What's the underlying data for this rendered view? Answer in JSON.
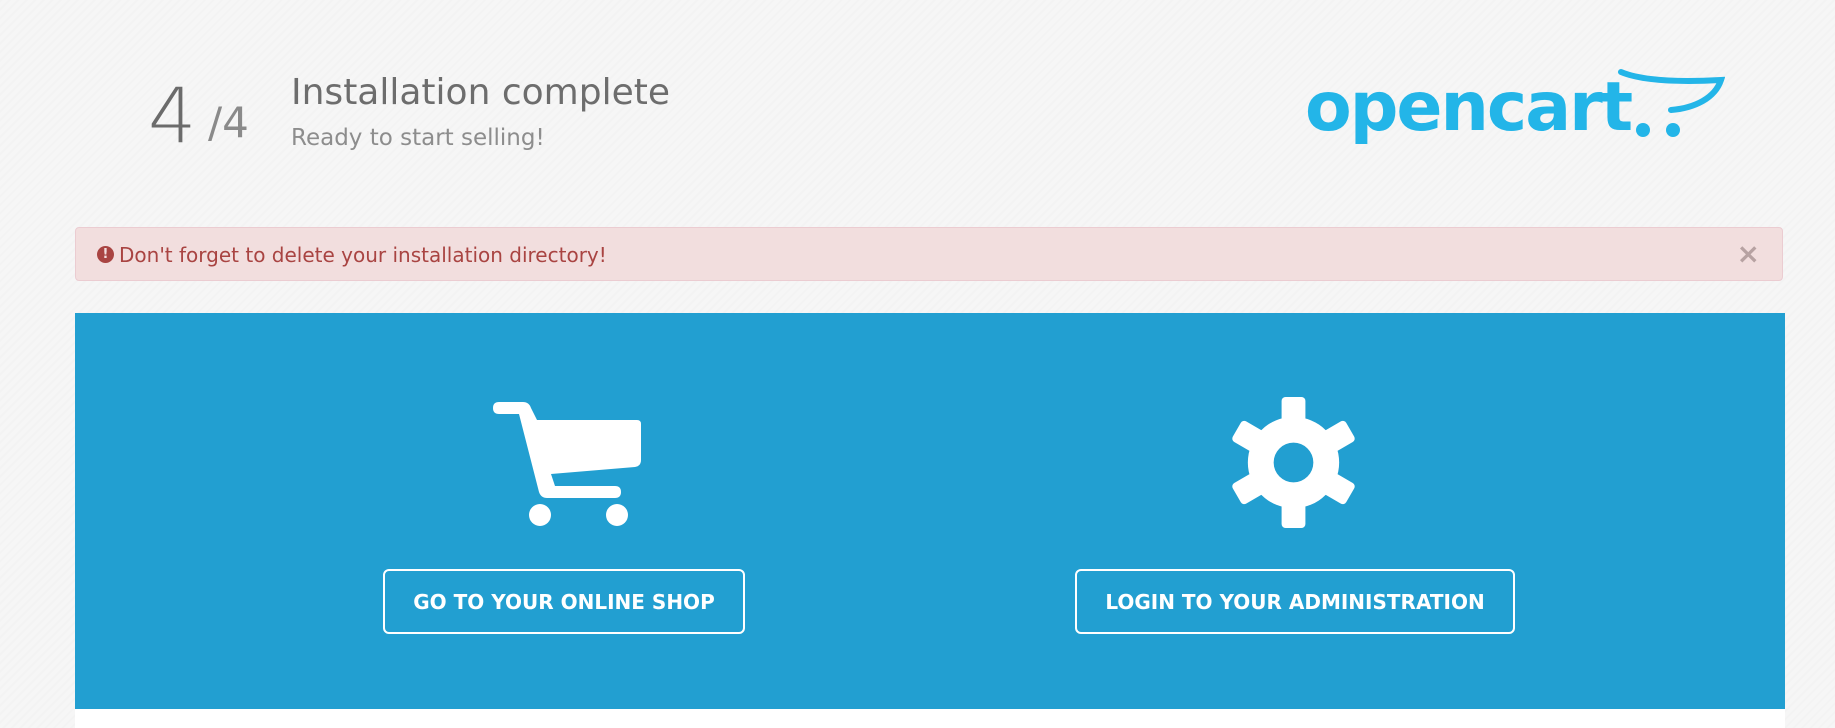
{
  "header": {
    "step_current": "4",
    "step_total": "/4",
    "title": "Installation complete",
    "subtitle": "Ready to start selling!"
  },
  "logo": {
    "text": "opencart",
    "color": "#23b5e8"
  },
  "alert": {
    "icon": "exclamation-circle-icon",
    "message": "Don't forget to delete your installation directory!",
    "close_label": "×",
    "background_color": "#f2dede",
    "text_color": "#a94442"
  },
  "actions": {
    "background_color": "#229fd1",
    "shop": {
      "icon": "shopping-cart-icon",
      "label": "GO TO YOUR ONLINE SHOP"
    },
    "admin": {
      "icon": "gear-icon",
      "label": "LOGIN TO YOUR ADMINISTRATION"
    }
  }
}
